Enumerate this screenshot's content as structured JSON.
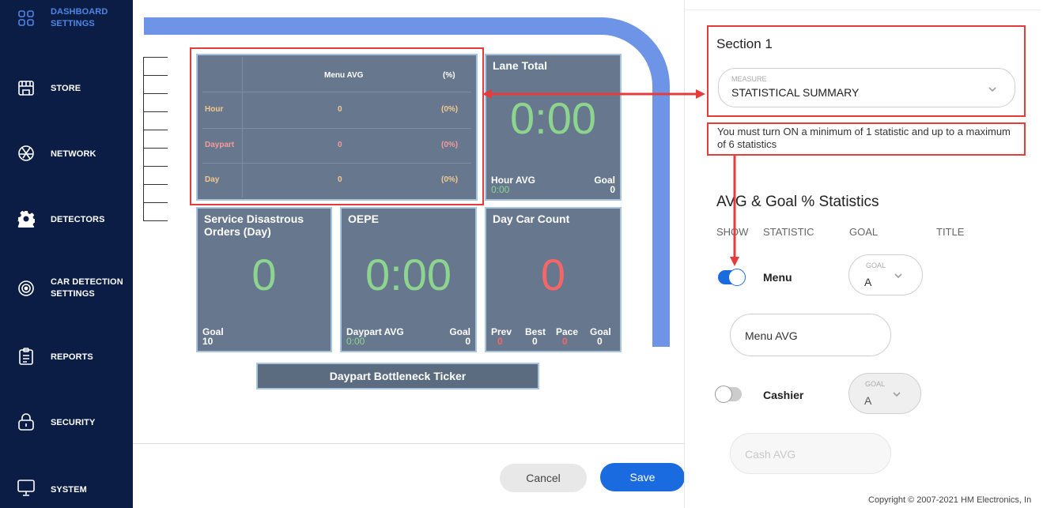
{
  "sidebar": {
    "items": [
      {
        "label_line1": "DASHBOARD",
        "label_line2": "SETTINGS",
        "icon": "grid-icon",
        "active": true
      },
      {
        "label": "STORE",
        "icon": "store-icon"
      },
      {
        "label": "NETWORK",
        "icon": "network-icon"
      },
      {
        "label": "DETECTORS",
        "icon": "gear-icon"
      },
      {
        "label_line1": "CAR DETECTION",
        "label_line2": "SETTINGS",
        "icon": "car-detection-icon"
      },
      {
        "label": "REPORTS",
        "icon": "clipboard-icon"
      },
      {
        "label": "SECURITY",
        "icon": "lock-icon"
      },
      {
        "label": "SYSTEM",
        "icon": "monitor-icon"
      }
    ]
  },
  "tiles": {
    "menu_avg": {
      "header_col1": "Menu AVG",
      "header_col2": "(%)",
      "rows": [
        {
          "label": "Hour",
          "value": "0",
          "pct": "(0%)"
        },
        {
          "label": "Daypart",
          "value": "0",
          "pct": "(0%)"
        },
        {
          "label": "Day",
          "value": "0",
          "pct": "(0%)"
        }
      ]
    },
    "lane_total": {
      "title": "Lane Total",
      "value": "0:00",
      "foot_left_label": "Hour AVG",
      "foot_left_value": "0:00",
      "foot_right_label": "Goal",
      "foot_right_value": "0"
    },
    "service_disastrous": {
      "title": "Service Disastrous Orders (Day)",
      "value": "0",
      "foot_label": "Goal",
      "foot_value": "10"
    },
    "oepe": {
      "title": "OEPE",
      "value": "0:00",
      "foot_left_label": "Daypart AVG",
      "foot_left_value": "0:00",
      "foot_right_label": "Goal",
      "foot_right_value": "0"
    },
    "day_car_count": {
      "title": "Day Car Count",
      "value": "0",
      "foot": [
        {
          "label": "Prev",
          "value": "0",
          "color": "#f56767"
        },
        {
          "label": "Best",
          "value": "0",
          "color": "#ffffff"
        },
        {
          "label": "Pace",
          "value": "0",
          "color": "#f56767"
        },
        {
          "label": "Goal",
          "value": "0",
          "color": "#ffffff"
        }
      ]
    },
    "ticker": {
      "title": "Daypart Bottleneck Ticker"
    }
  },
  "actions": {
    "cancel": "Cancel",
    "save": "Save"
  },
  "panel": {
    "section_title": "Section 1",
    "measure": {
      "label": "MEASURE",
      "value": "STATISTICAL SUMMARY"
    },
    "hint": "You must turn ON a minimum of 1 statistic and up to a maximum of 6 statistics",
    "stats_title": "AVG & Goal % Statistics",
    "columns": {
      "show": "SHOW",
      "statistic": "STATISTIC",
      "goal": "GOAL",
      "title": "TITLE"
    },
    "stats": [
      {
        "name": "Menu",
        "on": true,
        "goal_label": "GOAL",
        "goal_value": "A",
        "title_value": "Menu AVG"
      },
      {
        "name": "Cashier",
        "on": false,
        "goal_label": "GOAL",
        "goal_value": "A",
        "title_value": "Cash AVG"
      }
    ]
  },
  "copyright": "Copyright © 2007-2021 HM Electronics, In",
  "colors": {
    "sidebar": "#0b1d45",
    "accent": "#1a6ae0",
    "tile": "#66778e",
    "lane_outline": "#6d94e6",
    "highlight": "#e63b3b",
    "good": "#8dd58e",
    "bad": "#f56767"
  }
}
